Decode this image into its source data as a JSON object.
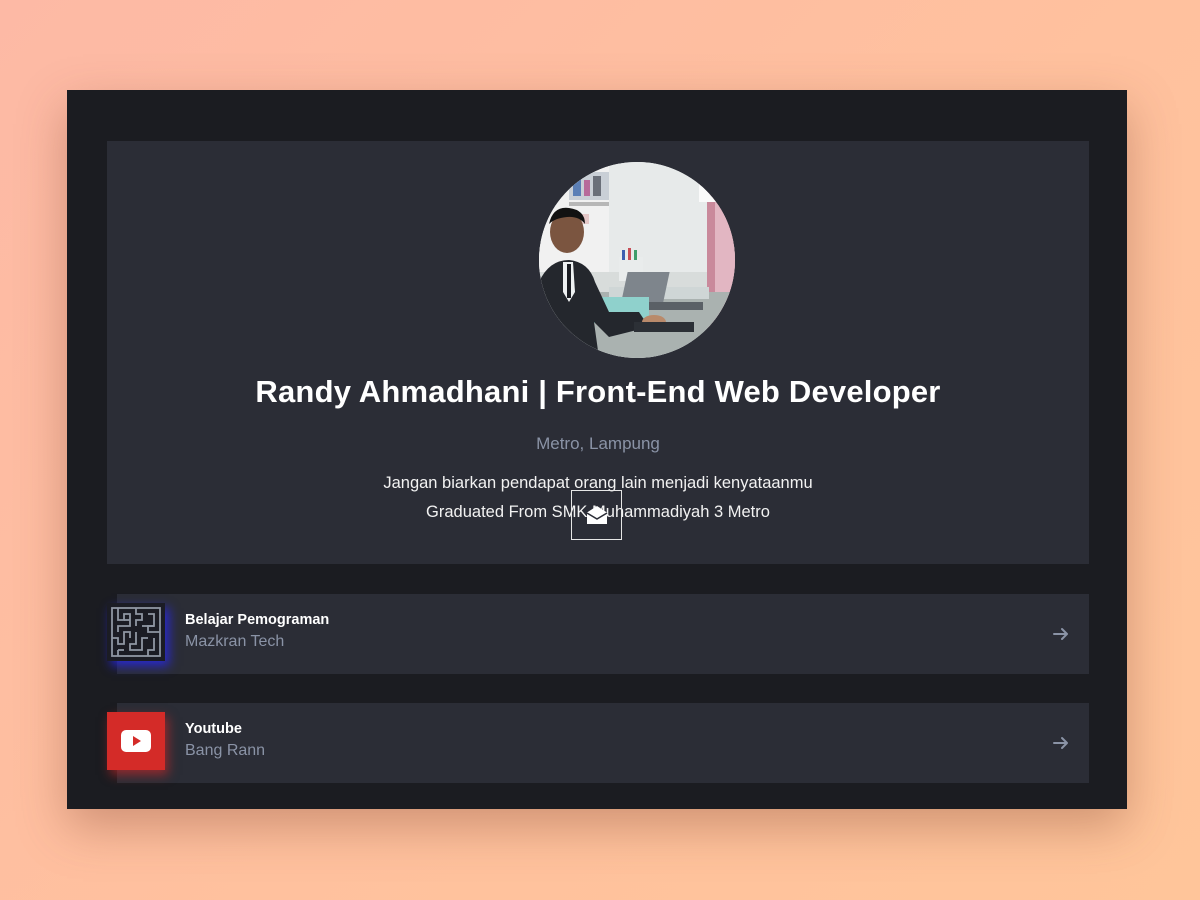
{
  "profile": {
    "name": "Randy Ahmadhani | Front-End Web Developer",
    "location": "Metro, Lampung",
    "bio_line1": "Jangan biarkan pendapat orang lain menjadi kenyataanmu",
    "bio_line2": "Graduated From SMK Muhammadiyah 3 Metro",
    "avatar_icon": "profile-photo",
    "contact_icon": "envelope-open-icon"
  },
  "links": [
    {
      "title": "Belajar Pemograman",
      "subtitle": "Mazkran Tech",
      "icon": "maze-logo-icon",
      "accent": "#2a2aff"
    },
    {
      "title": "Youtube",
      "subtitle": "Bang Rann",
      "icon": "youtube-icon",
      "accent": "#d42b28"
    }
  ],
  "colors": {
    "background_gradient": [
      "#fdb9a5",
      "#ffc59a"
    ],
    "window_bg": "#1b1c21",
    "card_bg": "#2b2d36",
    "muted_text": "#8a93a6",
    "youtube_red": "#d42b28"
  }
}
